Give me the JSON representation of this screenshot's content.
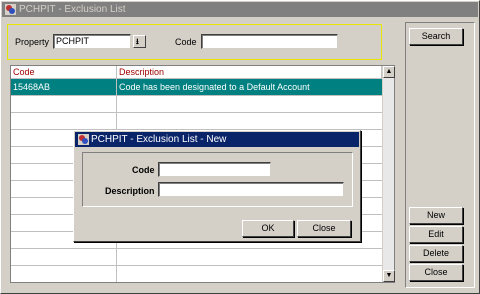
{
  "window": {
    "title": "PCHPIT - Exclusion List"
  },
  "filter": {
    "property_label": "Property",
    "property_value": "PCHPIT",
    "code_label": "Code",
    "code_value": ""
  },
  "buttons": {
    "search": "Search",
    "new": "New",
    "edit": "Edit",
    "delete": "Delete",
    "close": "Close"
  },
  "grid": {
    "columns": [
      "Code",
      "Description"
    ],
    "rows": [
      {
        "code": "15468AB",
        "description": "Code has been designated to a Default Account",
        "selected": true
      }
    ]
  },
  "dialog": {
    "title": "PCHPIT - Exclusion List - New",
    "code_label": "Code",
    "code_value": "",
    "description_label": "Description",
    "description_value": "",
    "ok_label": "OK",
    "close_label": "Close"
  },
  "colors": {
    "selection": "#008080",
    "header_text": "#a00000",
    "dialog_title": "#0a246a",
    "filter_border": "#e6e600"
  }
}
